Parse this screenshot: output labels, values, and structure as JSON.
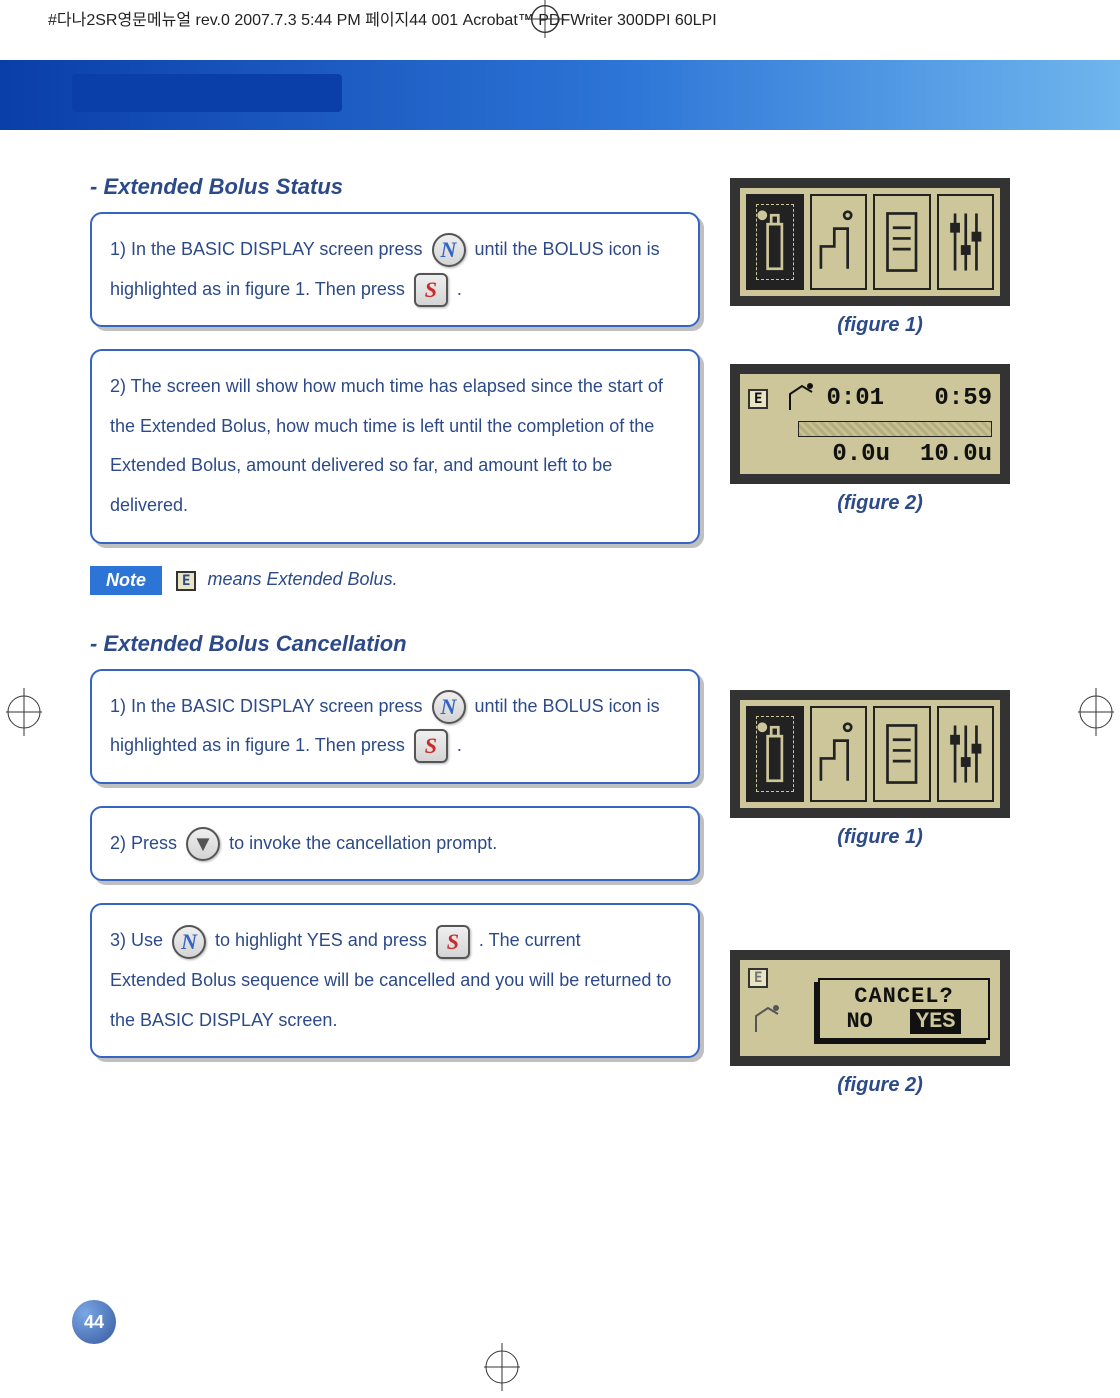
{
  "print_header": "#다나2SR영문메뉴얼 rev.0  2007.7.3 5:44 PM  페이지44   001 Acrobat™ PDFWriter 300DPI 60LPI",
  "page_number": "44",
  "sections": {
    "status": {
      "heading": "-   Extended Bolus Status",
      "step1_a": "1) In the BASIC DISPLAY screen press",
      "step1_b": "until the BOLUS icon is",
      "step1_c": "highlighted as in figure 1. Then press",
      "step1_d": ".",
      "step2": "2) The screen will show how much time has elapsed since the start of the Extended Bolus, how much time is left until the completion of the Extended Bolus, amount delivered so far, and amount left to be delivered.",
      "note_label": "Note",
      "note_e": "E",
      "note_text": "means Extended Bolus.",
      "fig1_caption": "(figure 1)",
      "fig2_caption": "(figure 2)",
      "chart_data": {
        "elapsed_time": "0:01",
        "remaining_time": "0:59",
        "delivered": "0.0u",
        "remaining_amount": "10.0u",
        "indicator": "E"
      }
    },
    "cancel": {
      "heading": "- Extended Bolus Cancellation",
      "step1_a": "1) In the BASIC DISPLAY screen press",
      "step1_b": "until the BOLUS icon is",
      "step1_c": "highlighted as in figure 1. Then press",
      "step1_d": ".",
      "step2_a": "2) Press",
      "step2_b": "to invoke the cancellation prompt.",
      "step3_a": "3) Use",
      "step3_b": "to highlight  YES  and press",
      "step3_c": ". The current",
      "step3_d": "Extended Bolus sequence will be cancelled and you will be returned to the BASIC DISPLAY screen.",
      "fig1_caption": "(figure 1)",
      "fig2_caption": "(figure 2)",
      "prompt": {
        "indicator": "E",
        "title": "CANCEL?",
        "no": "NO",
        "yes": "YES"
      }
    }
  },
  "buttons": {
    "n": "N",
    "s": "S",
    "down": "▼"
  }
}
